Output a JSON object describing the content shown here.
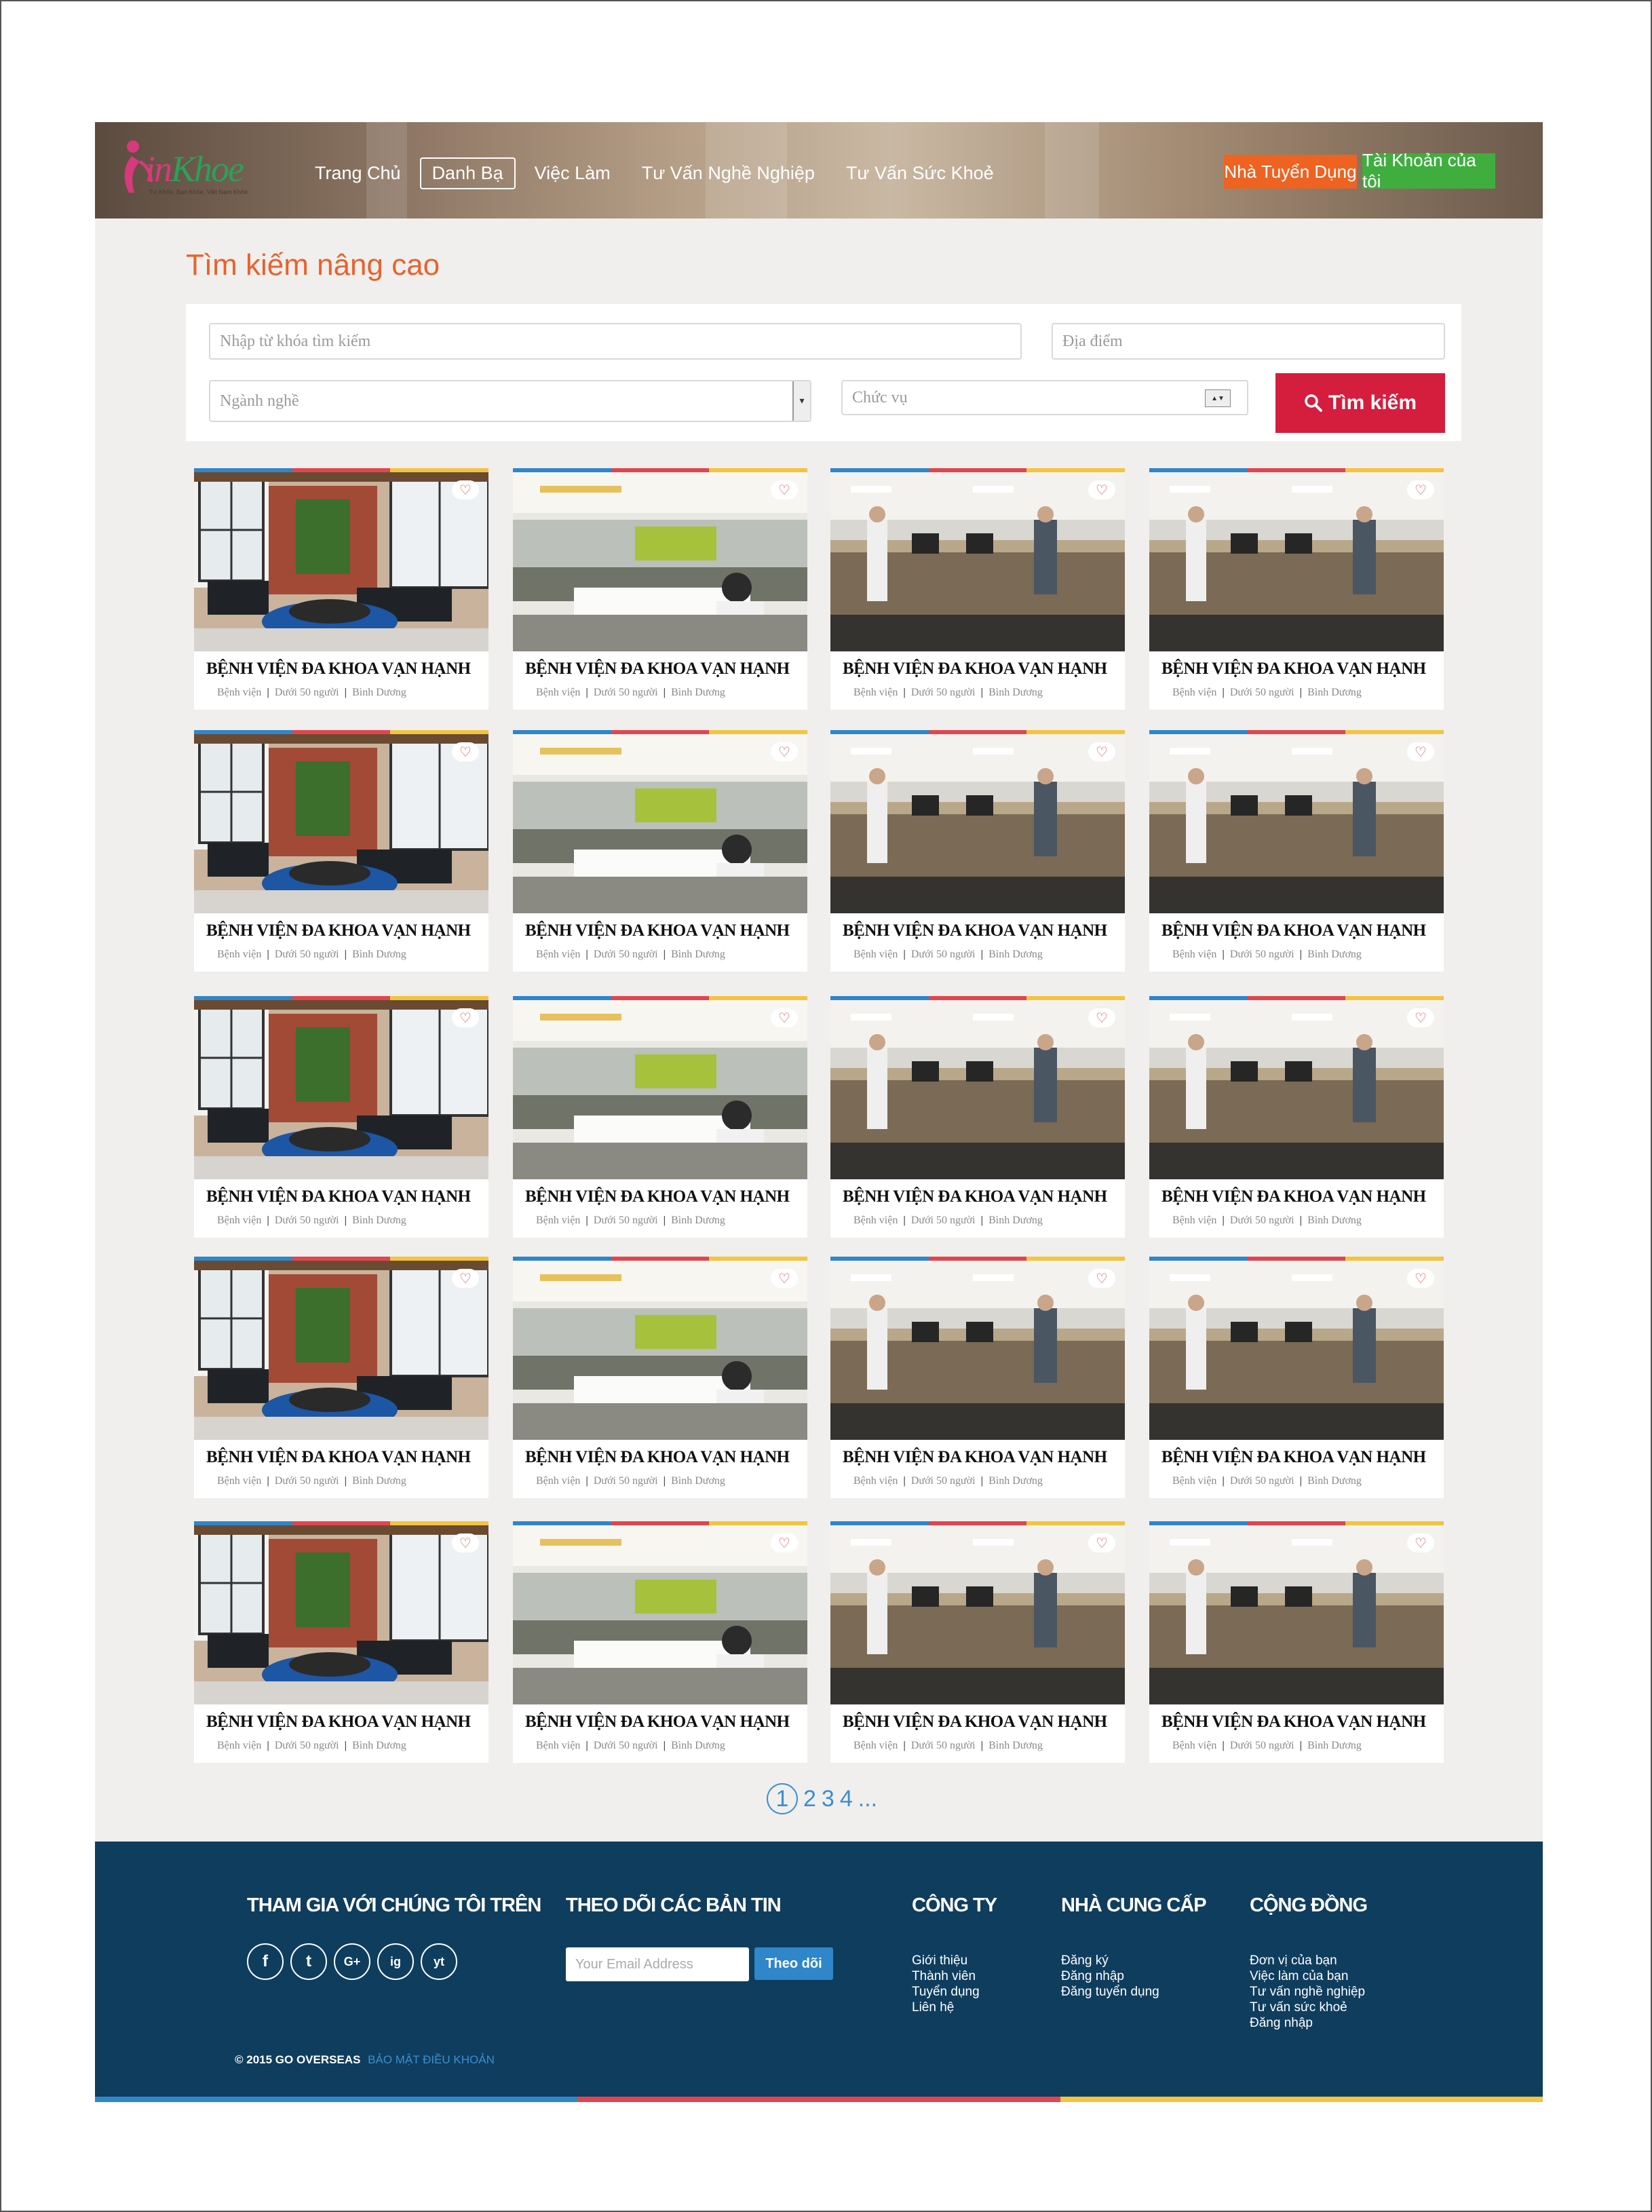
{
  "brand": {
    "name_left": "in",
    "name_right": "Khoe",
    "tagline": "Tư Khỏe, Bạn Khỏe, Việt Nam Khỏe"
  },
  "nav": [
    {
      "label": "Trang Chủ",
      "active": false
    },
    {
      "label": "Danh Bạ",
      "active": true
    },
    {
      "label": "Việc Làm",
      "active": false
    },
    {
      "label": "Tư Vấn Nghề Nghiệp",
      "active": false
    },
    {
      "label": "Tư Vấn Sức Khoẻ",
      "active": false
    }
  ],
  "header_buttons": {
    "employer": "Nhà Tuyển Dụng",
    "account": "Tài Khoản của tôi"
  },
  "search": {
    "title": "Tìm kiếm nâng cao",
    "keyword_placeholder": "Nhập từ khóa tìm kiếm",
    "location_placeholder": "Địa điểm",
    "industry_placeholder": "Ngành nghề",
    "position_placeholder": "Chức vụ",
    "button": "Tìm kiếm"
  },
  "card_template": {
    "name": "BỆNH VIỆN ĐA KHOA VẠN HẠNH",
    "type": "Bệnh viện",
    "size": "Dưới 50 người",
    "location": "Bình Dương"
  },
  "pagination": {
    "current": "1",
    "pages": [
      "2",
      "3",
      "4"
    ],
    "more": "..."
  },
  "footer": {
    "join_title": "THAM GIA VỚI CHÚNG TÔI TRÊN",
    "social": [
      "f",
      "t",
      "G+",
      "ig",
      "yt"
    ],
    "newsletter_title": "THEO DÕI CÁC BẢN TIN",
    "email_placeholder": "Your Email Address",
    "subscribe": "Theo dõi",
    "company_title": "CÔNG TY",
    "company_links": [
      "Giới thiệu",
      "Thành viên",
      "Tuyển dụng",
      "Liên hệ"
    ],
    "provider_title": "NHÀ CUNG CẤP",
    "provider_links": [
      "Đăng ký",
      "Đăng nhập",
      "Đăng tuyển dụng"
    ],
    "community_title": "CỘNG ĐỒNG",
    "community_links": [
      "Đơn vị của bạn",
      "Việc làm của bạn",
      "Tư vấn nghề nghiệp",
      "Tư vấn sức khoẻ",
      "Đăng nhập"
    ],
    "copyright": "© 2015 GO OVERSEAS",
    "terms": "BẢO MẬT ĐIỀU KHOẢN"
  },
  "colors": {
    "accent_orange": "#ee6322",
    "accent_green": "#3fae3f",
    "search_red": "#d51d3d",
    "footer_bg": "#0f3d5e",
    "stripe": [
      "#2f86c9",
      "#e0464f",
      "#f2c440"
    ]
  }
}
